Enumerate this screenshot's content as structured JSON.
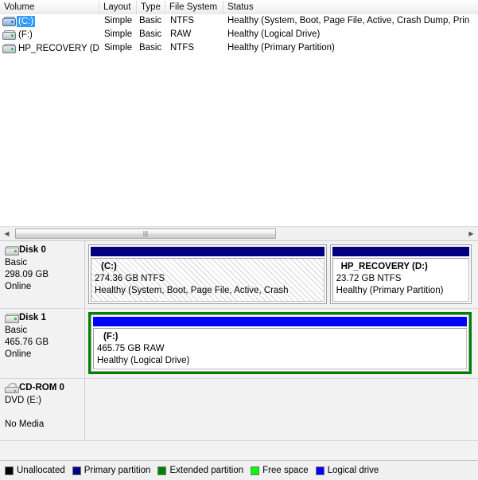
{
  "volume_list": {
    "columns": [
      {
        "key": "volume",
        "label": "Volume"
      },
      {
        "key": "layout",
        "label": "Layout"
      },
      {
        "key": "type",
        "label": "Type"
      },
      {
        "key": "filesystem",
        "label": "File System"
      },
      {
        "key": "status",
        "label": "Status"
      }
    ],
    "rows": [
      {
        "icon": "hard-drive-icon",
        "icon_color": "#84a9d3",
        "volume": "(C:)",
        "selected": true,
        "layout": "Simple",
        "type": "Basic",
        "filesystem": "NTFS",
        "status": "Healthy (System, Boot, Page File, Active, Crash Dump, Prin"
      },
      {
        "icon": "hard-drive-icon",
        "icon_color": "#cfd6dc",
        "volume": "(F:)",
        "selected": false,
        "layout": "Simple",
        "type": "Basic",
        "filesystem": "RAW",
        "status": "Healthy (Logical Drive)"
      },
      {
        "icon": "hard-drive-icon",
        "icon_color": "#cfd6dc",
        "volume": "HP_RECOVERY (D:)",
        "selected": false,
        "layout": "Simple",
        "type": "Basic",
        "filesystem": "NTFS",
        "status": "Healthy (Primary Partition)"
      }
    ]
  },
  "scrollbar": {
    "left_arrow": "◀",
    "right_arrow": "▶",
    "grip": "|||"
  },
  "disks": [
    {
      "icon": "disk-icon",
      "title": "Disk 0",
      "disk_type": "Basic",
      "capacity": "298.09 GB",
      "status": "Online",
      "partitions": [
        {
          "name": "(C:)",
          "size_fs": "274.36 GB NTFS",
          "health": "Healthy (System, Boot, Page File, Active, Crash",
          "bar_color": "#000080",
          "hatched": true,
          "width_pct": 63,
          "kind": "primary"
        },
        {
          "name": "HP_RECOVERY  (D:)",
          "size_fs": "23.72 GB NTFS",
          "health": "Healthy (Primary Partition)",
          "bar_color": "#000080",
          "hatched": false,
          "width_pct": 37,
          "kind": "primary"
        }
      ]
    },
    {
      "icon": "disk-icon",
      "title": "Disk 1",
      "disk_type": "Basic",
      "capacity": "465.76 GB",
      "status": "Online",
      "extended": true,
      "partitions": [
        {
          "name": "(F:)",
          "size_fs": "465.75 GB RAW",
          "health": "Healthy (Logical Drive)",
          "bar_color": "#0000ff",
          "hatched": false,
          "width_pct": 100,
          "kind": "logical"
        }
      ]
    },
    {
      "icon": "cd-rom-icon",
      "title": "CD-ROM 0",
      "disk_type": "DVD (E:)",
      "capacity": "",
      "status": "No Media",
      "partitions": []
    }
  ],
  "legend": [
    {
      "label": "Unallocated",
      "color": "#000000"
    },
    {
      "label": "Primary partition",
      "color": "#000080"
    },
    {
      "label": "Extended partition",
      "color": "#008000"
    },
    {
      "label": "Free space",
      "color": "#00ff00"
    },
    {
      "label": "Logical drive",
      "color": "#0000ff"
    }
  ]
}
